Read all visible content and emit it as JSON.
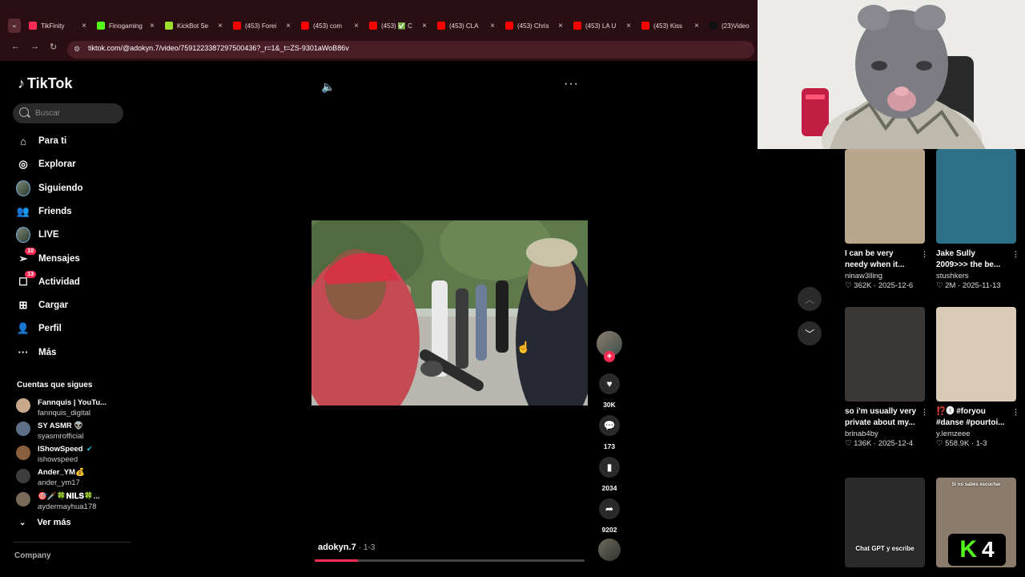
{
  "browser": {
    "tabs_menu_icon": "chevron-down-icon",
    "tabs": [
      {
        "title": "TikFinity",
        "favicon_color": "#fe2c55"
      },
      {
        "title": "Finogaming",
        "favicon_color": "#53fc18"
      },
      {
        "title": "KickBot Se",
        "favicon_color": "#9be22d"
      },
      {
        "title": "(453) Forei",
        "favicon_color": "#ff0000"
      },
      {
        "title": "(453) com",
        "favicon_color": "#ff0000"
      },
      {
        "title": "(453) ✅ C",
        "favicon_color": "#ff0000"
      },
      {
        "title": "(453) CLA",
        "favicon_color": "#ff0000"
      },
      {
        "title": "(453) Chris",
        "favicon_color": "#ff0000"
      },
      {
        "title": "(453) LA U",
        "favicon_color": "#ff0000"
      },
      {
        "title": "(453) Kiss",
        "favicon_color": "#ff0000"
      },
      {
        "title": "(23)Video",
        "favicon_color": "#111111"
      }
    ],
    "url": "tiktok.com/@adokyn.7/video/7591223387297500436?_r=1&_t=ZS-9301aWoB86v"
  },
  "sidebar": {
    "logo_text": "TikTok",
    "search_placeholder": "Buscar",
    "nav": [
      {
        "label": "Para ti",
        "icon": "home-icon"
      },
      {
        "label": "Explorar",
        "icon": "compass-icon"
      },
      {
        "label": "Siguiendo",
        "icon": "avatar-icon"
      },
      {
        "label": "Friends",
        "icon": "friends-icon"
      },
      {
        "label": "LIVE",
        "icon": "live-avatar-icon"
      },
      {
        "label": "Mensajes",
        "icon": "send-icon",
        "badge": "10"
      },
      {
        "label": "Actividad",
        "icon": "inbox-icon",
        "badge": "13"
      },
      {
        "label": "Cargar",
        "icon": "upload-icon"
      },
      {
        "label": "Perfil",
        "icon": "profile-icon"
      },
      {
        "label": "Más",
        "icon": "more-icon"
      }
    ],
    "following_title": "Cuentas que sigues",
    "following": [
      {
        "name": "Fannquis | YouTu...",
        "handle": "fannquis_digital"
      },
      {
        "name": "SY ASMR 👽",
        "handle": "syasmrofficial"
      },
      {
        "name": "IShowSpeed",
        "handle": "ishowspeed",
        "verified": true
      },
      {
        "name": "Ander_YM💰",
        "handle": "ander_ym17"
      },
      {
        "name": "🎯🗡️🍀𝐍𝐈𝐋𝐒🍀...",
        "handle": "aydermayhua178"
      }
    ],
    "see_more": "Ver más",
    "footer": "Company"
  },
  "player": {
    "creator": "adokyn.7",
    "date": "1-3",
    "progress_fraction": 0.16,
    "likes": "30K",
    "comments": "173",
    "saves": "2034",
    "shares": "9202"
  },
  "recommendations": [
    {
      "caption_1": "I can be very",
      "caption_2": "needy when it...",
      "author": "ninaw3lling",
      "likes": "362K",
      "date": "2025-12-6"
    },
    {
      "caption_1": "Jake Sully",
      "caption_2": "2009>>> the be...",
      "author": "stushkers",
      "likes": "2M",
      "date": "2025-11-13"
    },
    {
      "caption_1": "so i'm usually very",
      "caption_2": "private about my...",
      "author": "brinab4by",
      "likes": "136K",
      "date": "2025-12-4"
    },
    {
      "caption_1": "⁉️🅧 #foryou",
      "caption_2": "#danse #pourtoi...",
      "author": "y.lemzeee",
      "likes": "558.9K",
      "date": "1-3"
    },
    {
      "overlay_text": "Chat GPT y escribe"
    },
    {
      "overlay_text": "Si no sabés escuchar"
    }
  ],
  "overlay": {
    "kick_number": "4"
  }
}
